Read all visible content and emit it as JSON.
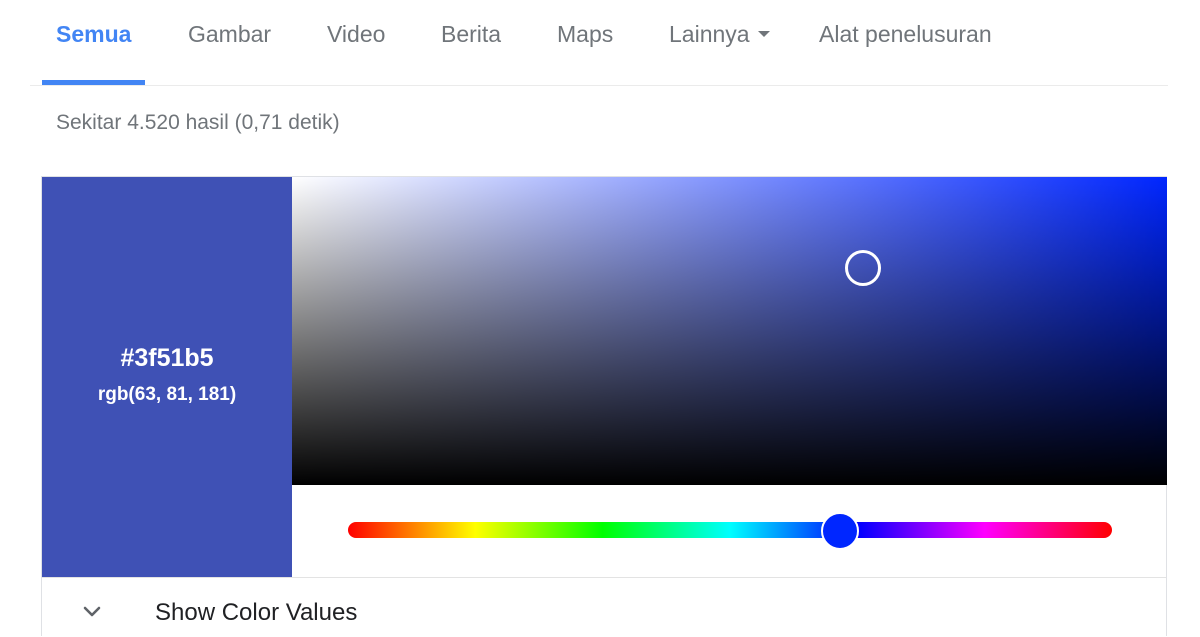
{
  "tabs": [
    {
      "label": "Semua",
      "active": true
    },
    {
      "label": "Gambar",
      "active": false
    },
    {
      "label": "Video",
      "active": false
    },
    {
      "label": "Berita",
      "active": false
    },
    {
      "label": "Maps",
      "active": false
    },
    {
      "label": "Lainnya",
      "active": false
    },
    {
      "label": "Alat penelusuran",
      "active": false
    }
  ],
  "result_stats": "Sekitar 4.520 hasil (0,71 detik)",
  "color_picker": {
    "hex": "#3f51b5",
    "rgb": "rgb(63, 81, 181)",
    "hue_color": "#0026ff",
    "show_values_label": "Show Color Values"
  },
  "colors": {
    "accent": "#4285f4",
    "tab_text": "#70757a",
    "selected_color": "#3f51b5"
  },
  "icons": {
    "more_dropdown": "caret-down-icon",
    "show_values_toggle": "chevron-down-icon"
  }
}
